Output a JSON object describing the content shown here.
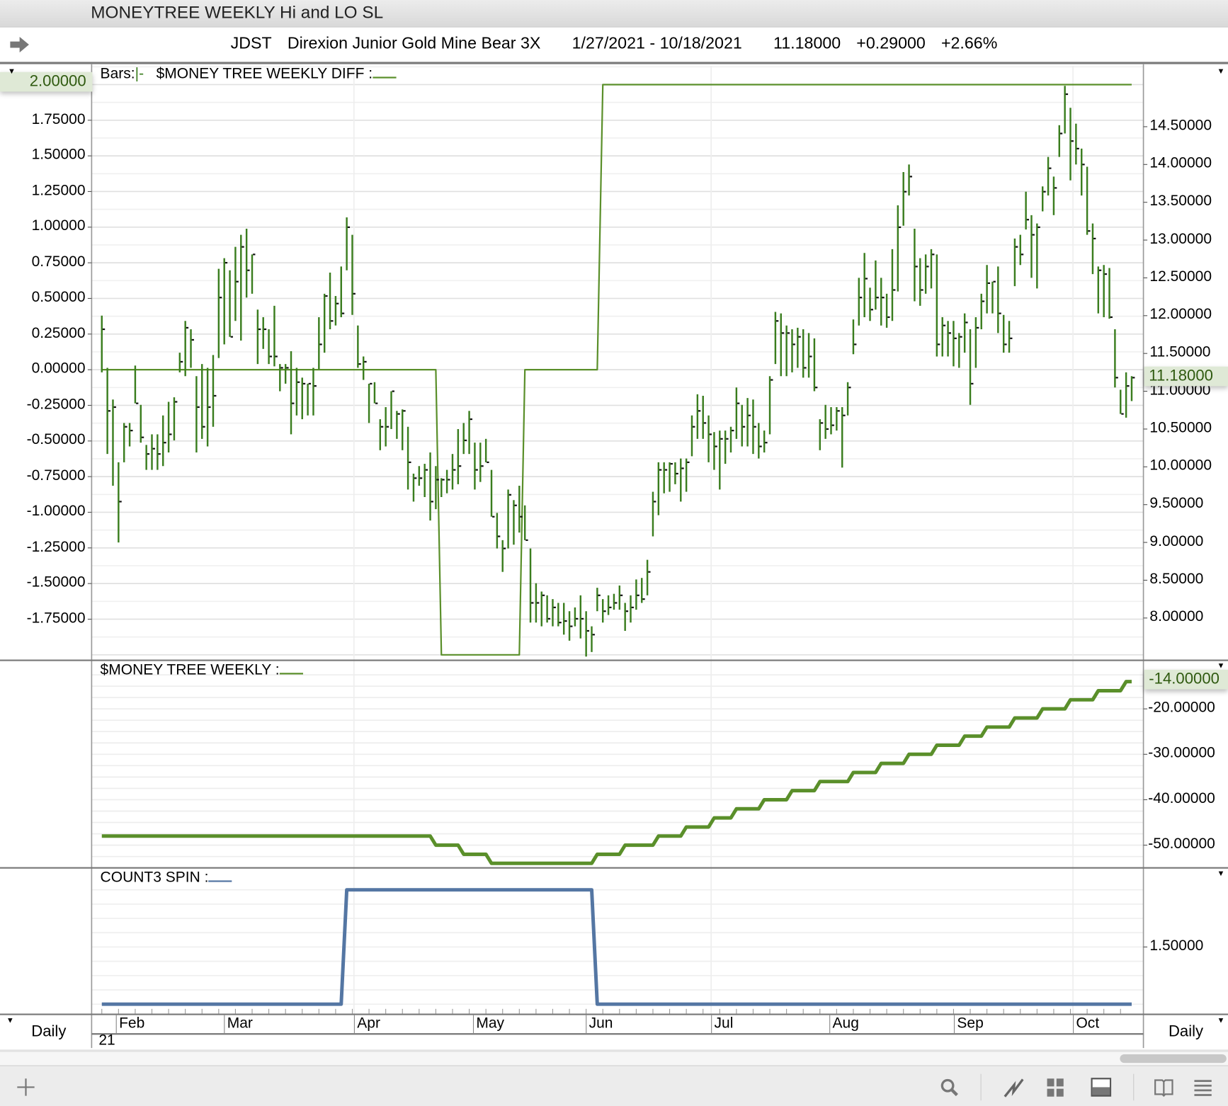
{
  "window": {
    "title": "MONEYTREE WEEKLY Hi and LO SL"
  },
  "header": {
    "symbol": "JDST",
    "name": "Direxion Junior Gold Mine Bear 3X",
    "date_range": "1/27/2021 - 10/18/2021",
    "last": "11.18000",
    "change": "+0.29000",
    "change_pct": "+2.66%"
  },
  "x_axis": {
    "months": [
      "Feb",
      "Mar",
      "Apr",
      "May",
      "Jun",
      "Jul",
      "Aug",
      "Sep",
      "Oct"
    ],
    "year": "21",
    "period_left": "Daily",
    "period_right": "Daily"
  },
  "colors": {
    "bars": "#3a7d1e",
    "diff_line": "#5a8f2a",
    "money_line": "#5a8f2a",
    "count_line": "#5476a3",
    "highlight_bg": "#dfe9d6"
  },
  "toolbar": {
    "icons": [
      "plus-icon",
      "search-icon",
      "line-chart-icon",
      "grid-icon",
      "panel-icon",
      "book-icon",
      "menu-icon"
    ]
  },
  "chart_data": [
    {
      "type": "bar",
      "subtype": "hlc",
      "title": "Bars",
      "legend_bars": "Bars:",
      "legend_glyph": "|-",
      "legend_indicator": "$MONEY TREE WEEKLY DIFF :",
      "fields": [
        "high",
        "low",
        "close"
      ],
      "right_axis": {
        "labels": [
          "14.50000",
          "14.00000",
          "13.50000",
          "13.00000",
          "12.50000",
          "12.00000",
          "11.50000",
          "11.00000",
          "10.50000",
          "10.00000",
          "9.50000",
          "9.00000",
          "8.50000",
          "8.00000"
        ],
        "current": "11.18000"
      },
      "left_axis": {
        "labels": [
          "1.75000",
          "1.50000",
          "1.25000",
          "1.00000",
          "0.75000",
          "0.50000",
          "0.25000",
          "0.00000",
          "-0.25000",
          "-0.50000",
          "-0.75000",
          "-1.00000",
          "-1.25000",
          "-1.50000",
          "-1.75000"
        ],
        "current": "2.00000"
      },
      "bars": [
        [
          12.0,
          11.25,
          11.82
        ],
        [
          11.31,
          10.17,
          10.74
        ],
        [
          10.89,
          9.75,
          10.79
        ],
        [
          10.06,
          9.0,
          9.54
        ],
        [
          10.58,
          10.06,
          10.53
        ],
        [
          10.58,
          10.27,
          10.48
        ],
        [
          11.34,
          10.84,
          10.84
        ],
        [
          10.82,
          10.32,
          10.39
        ],
        [
          10.29,
          9.96,
          10.17
        ],
        [
          10.43,
          9.96,
          10.24
        ],
        [
          10.43,
          9.96,
          10.17
        ],
        [
          10.68,
          10.01,
          10.32
        ],
        [
          10.86,
          10.19,
          10.43
        ],
        [
          10.92,
          10.35,
          10.86
        ],
        [
          11.51,
          11.25,
          11.39
        ],
        [
          11.93,
          11.2,
          11.84
        ],
        [
          11.82,
          11.31,
          11.68
        ],
        [
          11.2,
          10.19,
          10.79
        ],
        [
          11.36,
          10.37,
          10.53
        ],
        [
          11.31,
          10.27,
          10.79
        ],
        [
          11.48,
          10.53,
          10.94
        ],
        [
          12.62,
          11.44,
          12.24
        ],
        [
          12.76,
          11.62,
          12.7
        ],
        [
          12.6,
          11.72,
          11.72
        ],
        [
          12.91,
          11.93,
          12.45
        ],
        [
          13.07,
          11.67,
          12.91
        ],
        [
          13.15,
          12.24,
          12.6
        ],
        [
          12.81,
          12.29,
          12.81
        ],
        [
          12.08,
          11.36,
          11.82
        ],
        [
          11.98,
          11.56,
          11.82
        ],
        [
          11.82,
          11.36,
          11.46
        ],
        [
          12.13,
          11.33,
          11.46
        ],
        [
          11.36,
          11.0,
          11.31
        ],
        [
          11.36,
          11.1,
          11.31
        ],
        [
          11.53,
          10.43,
          10.84
        ],
        [
          11.31,
          10.68,
          11.12
        ],
        [
          11.18,
          10.63,
          11.1
        ],
        [
          11.1,
          10.68,
          11.1
        ],
        [
          11.31,
          10.68,
          11.07
        ],
        [
          11.98,
          11.29,
          11.62
        ],
        [
          12.29,
          11.51,
          12.26
        ],
        [
          12.57,
          11.82,
          11.93
        ],
        [
          12.26,
          11.87,
          12.16
        ],
        [
          12.65,
          11.98,
          12.03
        ],
        [
          13.3,
          12.6,
          13.17
        ],
        [
          13.07,
          12.01,
          12.29
        ],
        [
          11.87,
          11.31,
          11.36
        ],
        [
          11.46,
          11.15,
          11.39
        ],
        [
          11.1,
          10.58,
          11.1
        ],
        [
          11.12,
          10.84,
          10.84
        ],
        [
          10.63,
          10.22,
          10.53
        ],
        [
          10.79,
          10.27,
          10.53
        ],
        [
          11.0,
          10.5,
          11.0
        ],
        [
          10.74,
          10.37,
          10.7
        ],
        [
          10.76,
          10.22,
          10.74
        ],
        [
          10.53,
          9.7,
          10.06
        ],
        [
          9.91,
          9.54,
          9.85
        ],
        [
          10.01,
          9.75,
          9.85
        ],
        [
          10.04,
          9.6,
          9.96
        ],
        [
          10.19,
          9.29,
          9.54
        ],
        [
          10.01,
          9.44,
          9.83
        ],
        [
          9.85,
          9.6,
          9.83
        ],
        [
          9.96,
          9.65,
          9.83
        ],
        [
          10.17,
          9.7,
          9.96
        ],
        [
          10.5,
          9.77,
          10.01
        ],
        [
          10.58,
          10.17,
          10.35
        ],
        [
          10.74,
          10.17,
          10.63
        ],
        [
          10.32,
          9.7,
          9.96
        ],
        [
          10.32,
          9.8,
          10.01
        ],
        [
          10.37,
          10.06,
          10.06
        ],
        [
          9.96,
          9.34,
          9.34
        ],
        [
          9.39,
          8.92,
          9.08
        ],
        [
          9.03,
          8.61,
          8.92
        ],
        [
          9.7,
          8.92,
          9.63
        ],
        [
          9.56,
          8.97,
          9.49
        ],
        [
          9.75,
          9.13,
          9.34
        ],
        [
          9.49,
          9.03,
          9.03
        ],
        [
          8.92,
          7.94,
          8.2
        ],
        [
          8.46,
          7.94,
          8.2
        ],
        [
          8.35,
          7.89,
          8.3
        ],
        [
          8.3,
          7.94,
          7.99
        ],
        [
          8.25,
          7.89,
          8.14
        ],
        [
          8.2,
          7.89,
          7.94
        ],
        [
          8.2,
          7.78,
          7.96
        ],
        [
          8.09,
          7.7,
          7.89
        ],
        [
          8.14,
          7.89,
          7.99
        ],
        [
          8.3,
          7.73,
          7.99
        ],
        [
          8.09,
          7.49,
          7.83
        ],
        [
          7.89,
          7.55,
          7.78
        ],
        [
          8.4,
          8.09,
          8.3
        ],
        [
          8.25,
          7.94,
          8.09
        ],
        [
          8.3,
          8.04,
          8.14
        ],
        [
          8.32,
          8.11,
          8.2
        ],
        [
          8.43,
          8.11,
          8.3
        ],
        [
          8.2,
          7.83,
          8.09
        ],
        [
          8.3,
          7.94,
          8.14
        ],
        [
          8.51,
          8.11,
          8.3
        ],
        [
          8.53,
          8.2,
          8.25
        ],
        [
          8.77,
          8.3,
          8.61
        ],
        [
          9.67,
          9.08,
          9.54
        ],
        [
          10.06,
          9.36,
          9.96
        ],
        [
          10.06,
          9.65,
          9.96
        ],
        [
          10.06,
          9.67,
          10.04
        ],
        [
          10.06,
          9.77,
          9.91
        ],
        [
          10.11,
          9.54,
          9.98
        ],
        [
          10.11,
          9.67,
          10.06
        ],
        [
          10.68,
          10.14,
          10.53
        ],
        [
          10.96,
          10.37,
          10.74
        ],
        [
          10.94,
          10.37,
          10.58
        ],
        [
          10.68,
          10.06,
          10.43
        ],
        [
          10.46,
          9.96,
          10.27
        ],
        [
          10.48,
          9.7,
          10.37
        ],
        [
          10.48,
          10.04,
          10.37
        ],
        [
          10.53,
          10.19,
          10.48
        ],
        [
          11.05,
          10.37,
          10.84
        ],
        [
          10.82,
          10.27,
          10.53
        ],
        [
          10.91,
          10.27,
          10.68
        ],
        [
          10.89,
          10.17,
          10.53
        ],
        [
          10.58,
          10.11,
          10.27
        ],
        [
          10.48,
          10.19,
          10.32
        ],
        [
          11.2,
          10.43,
          11.15
        ],
        [
          12.05,
          11.36,
          11.93
        ],
        [
          12.03,
          11.2,
          11.77
        ],
        [
          11.87,
          11.2,
          11.77
        ],
        [
          11.82,
          11.25,
          11.62
        ],
        [
          11.84,
          11.31,
          11.72
        ],
        [
          11.82,
          11.18,
          11.31
        ],
        [
          11.77,
          11.18,
          11.46
        ],
        [
          11.7,
          11.0,
          11.05
        ],
        [
          10.63,
          10.22,
          10.58
        ],
        [
          10.82,
          10.37,
          10.5
        ],
        [
          10.79,
          10.43,
          10.55
        ],
        [
          10.79,
          10.48,
          10.74
        ],
        [
          10.79,
          9.99,
          10.68
        ],
        [
          11.12,
          10.68,
          11.05
        ],
        [
          11.95,
          11.49,
          11.62
        ],
        [
          12.5,
          11.87,
          12.24
        ],
        [
          12.83,
          11.98,
          12.49
        ],
        [
          12.37,
          11.93,
          12.08
        ],
        [
          12.73,
          12.08,
          12.24
        ],
        [
          12.5,
          11.87,
          12.24
        ],
        [
          12.29,
          11.84,
          11.98
        ],
        [
          12.88,
          11.93,
          12.34
        ],
        [
          13.46,
          12.32,
          13.17
        ],
        [
          13.9,
          13.19,
          13.64
        ],
        [
          14.0,
          13.59,
          13.84
        ],
        [
          13.15,
          12.19,
          12.65
        ],
        [
          12.76,
          12.13,
          12.34
        ],
        [
          12.81,
          12.29,
          12.65
        ],
        [
          12.88,
          12.36,
          12.81
        ],
        [
          12.81,
          11.46,
          11.62
        ],
        [
          11.98,
          11.46,
          11.87
        ],
        [
          11.93,
          11.46,
          11.77
        ],
        [
          11.93,
          11.33,
          11.7
        ],
        [
          11.77,
          11.31,
          11.72
        ],
        [
          12.03,
          11.51,
          11.91
        ],
        [
          11.82,
          10.82,
          11.1
        ],
        [
          11.98,
          11.31,
          11.84
        ],
        [
          12.29,
          11.82,
          12.19
        ],
        [
          12.67,
          12.03,
          12.43
        ],
        [
          12.45,
          12.03,
          12.45
        ],
        [
          12.65,
          11.77,
          12.03
        ],
        [
          12.01,
          11.51,
          11.62
        ],
        [
          11.93,
          11.51,
          11.7
        ],
        [
          13.02,
          12.39,
          12.91
        ],
        [
          13.07,
          12.67,
          12.81
        ],
        [
          13.64,
          13.14,
          13.27
        ],
        [
          13.33,
          12.5,
          13.07
        ],
        [
          13.22,
          12.36,
          13.17
        ],
        [
          13.71,
          13.38,
          13.64
        ],
        [
          14.1,
          13.59,
          13.95
        ],
        [
          13.84,
          13.33,
          13.69
        ],
        [
          14.52,
          14.1,
          14.41
        ],
        [
          15.04,
          14.41,
          14.93
        ],
        [
          14.75,
          13.79,
          14.31
        ],
        [
          14.54,
          14.0,
          14.21
        ],
        [
          14.21,
          13.59,
          14.0
        ],
        [
          13.97,
          13.07,
          13.12
        ],
        [
          13.22,
          12.55,
          13.02
        ],
        [
          12.65,
          12.03,
          12.6
        ],
        [
          12.67,
          11.98,
          12.55
        ],
        [
          12.63,
          11.96,
          11.98
        ],
        [
          11.82,
          11.05,
          11.18
        ],
        [
          11.02,
          10.7,
          10.7
        ],
        [
          11.25,
          10.65,
          11.07
        ],
        [
          11.2,
          10.87,
          11.18
        ]
      ],
      "diff_steps": [
        [
          0,
          0
        ],
        [
          61,
          -2
        ],
        [
          76,
          0
        ],
        [
          90,
          2
        ]
      ]
    },
    {
      "type": "line",
      "title": "$MONEY TREE WEEKLY",
      "legend": "$MONEY TREE WEEKLY :",
      "axis": {
        "labels": [
          "-20.00000",
          "-30.00000",
          "-40.00000",
          "-50.00000"
        ],
        "current": "-14.00000"
      },
      "steps": [
        [
          0,
          -48
        ],
        [
          60,
          -50
        ],
        [
          65,
          -52
        ],
        [
          70,
          -54
        ],
        [
          89,
          -52
        ],
        [
          94,
          -50
        ],
        [
          100,
          -48
        ],
        [
          105,
          -46
        ],
        [
          110,
          -44
        ],
        [
          114,
          -42
        ],
        [
          119,
          -40
        ],
        [
          124,
          -38
        ],
        [
          129,
          -36
        ],
        [
          135,
          -34
        ],
        [
          140,
          -32
        ],
        [
          145,
          -30
        ],
        [
          150,
          -28
        ],
        [
          155,
          -26
        ],
        [
          159,
          -24
        ],
        [
          164,
          -22
        ],
        [
          169,
          -20
        ],
        [
          174,
          -18
        ],
        [
          179,
          -16
        ],
        [
          184,
          -14
        ]
      ]
    },
    {
      "type": "line",
      "title": "COUNT3 SPIN",
      "legend": "COUNT3 SPIN :",
      "axis": {
        "labels": [
          "1.50000"
        ]
      },
      "steps": [
        [
          0,
          1
        ],
        [
          44,
          2
        ],
        [
          89,
          1
        ]
      ]
    }
  ]
}
